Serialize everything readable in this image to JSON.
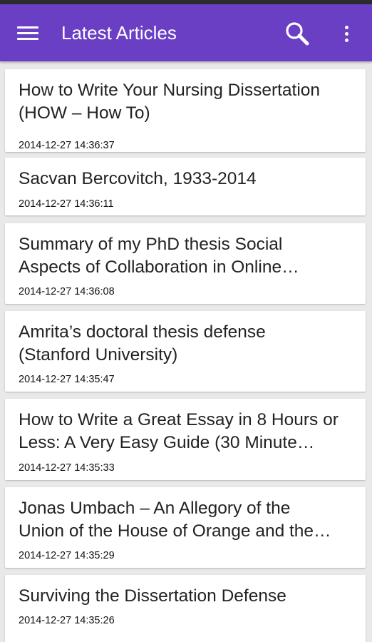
{
  "appbar": {
    "title": "Latest Articles",
    "menu_icon": "hamburger-menu-icon",
    "search_icon": "search-icon",
    "overflow_icon": "more-vertical-icon",
    "color": "#6a3fc4"
  },
  "articles": [
    {
      "line1": "How to Write Your Nursing Dissertation",
      "line2": "(HOW – How To)",
      "date": "2014-12-27 14:36:37"
    },
    {
      "line1": "Sacvan Bercovitch, 1933-2014",
      "line2": "",
      "date": "2014-12-27 14:36:11"
    },
    {
      "line1": "Summary of my PhD thesis Social",
      "line2": "Aspects of Collaboration in Online…",
      "date": "2014-12-27 14:36:08"
    },
    {
      "line1": "Amrita’s doctoral thesis defense",
      "line2": "(Stanford University)",
      "date": "2014-12-27 14:35:47"
    },
    {
      "line1": "How to Write a Great Essay in 8 Hours or",
      "line2": "Less: A Very Easy Guide (30 Minute…",
      "date": "2014-12-27 14:35:33"
    },
    {
      "line1": "Jonas Umbach – An Allegory of the",
      "line2": "Union of the House of Orange and the…",
      "date": "2014-12-27 14:35:29"
    },
    {
      "line1": "Surviving the Dissertation Defense",
      "line2": "",
      "date": "2014-12-27 14:35:26"
    }
  ]
}
